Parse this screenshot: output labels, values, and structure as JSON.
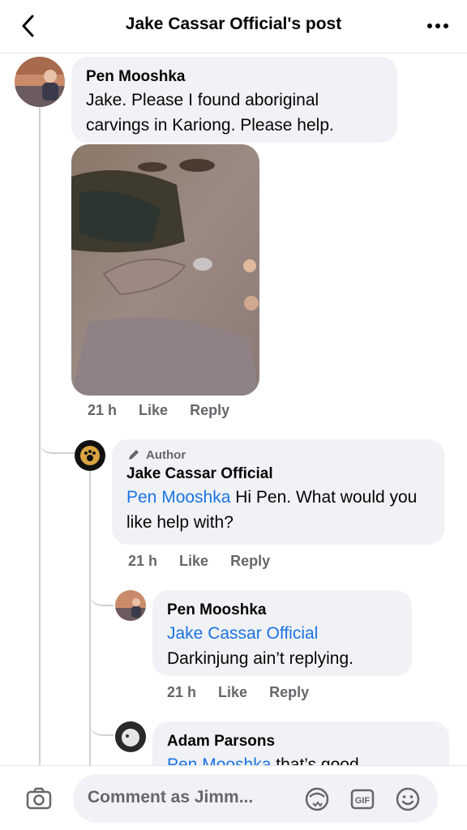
{
  "header": {
    "title": "Jake Cassar Official's post"
  },
  "comments": [
    {
      "author": "Pen Mooshka",
      "text": "Jake. Please I found aboriginal carvings in Kariong. Please help.",
      "time": "21 h",
      "like_label": "Like",
      "reply_label": "Reply"
    },
    {
      "badge": "Author",
      "author": "Jake Cassar Official",
      "mention": "Pen Mooshka",
      "text": " Hi Pen. What would you like help with?",
      "time": "21 h",
      "like_label": "Like",
      "reply_label": "Reply"
    },
    {
      "author": "Pen Mooshka",
      "mention": "Jake Cassar Official",
      "text": "Darkinjung ain’t replying.",
      "time": "21 h",
      "like_label": "Like",
      "reply_label": "Reply"
    },
    {
      "author": "Adam Parsons",
      "mention": "Pen Mooshka",
      "text": " that’s good"
    }
  ],
  "composer": {
    "placeholder": "Comment as Jimm...",
    "icons": [
      "camera-icon",
      "avatar-sticker-icon",
      "gif-icon",
      "emoji-icon"
    ]
  },
  "colors": {
    "mention": "#1b74e4",
    "bubble": "#f0f2f5",
    "meta": "#65676b"
  }
}
